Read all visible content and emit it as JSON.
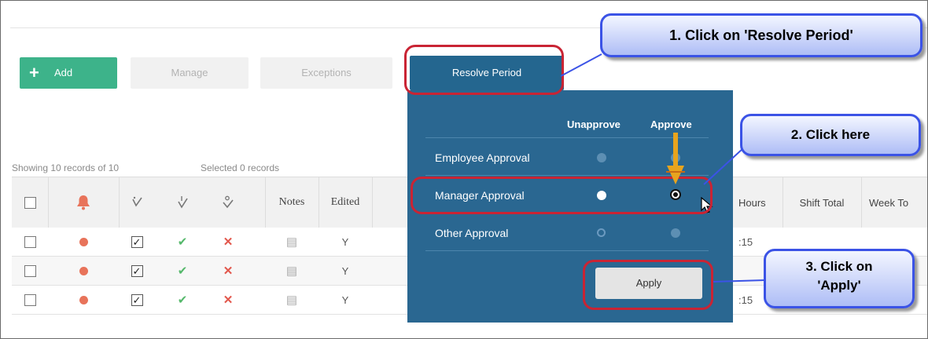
{
  "toolbar": {
    "add_label": "Add",
    "manage_label": "Manage",
    "exceptions_label": "Exceptions",
    "resolve_label": "Resolve Period"
  },
  "records": {
    "showing": "Showing 10 records of 10",
    "selected": "Selected 0 records"
  },
  "table": {
    "headers": {
      "notes": "Notes",
      "edited": "Edited",
      "hours": "Hours",
      "shift_total": "Shift Total",
      "week_total": "Week To"
    },
    "rows": [
      {
        "edited": "Y",
        "hours": ":15"
      },
      {
        "edited": "Y",
        "hours": ""
      },
      {
        "edited": "Y",
        "hours": ":15"
      }
    ]
  },
  "resolve_panel": {
    "col_unapprove": "Unapprove",
    "col_approve": "Approve",
    "rows": [
      {
        "label": "Employee Approval",
        "unapprove": "dim",
        "approve": "dim"
      },
      {
        "label": "Manager Approval",
        "unapprove": "on",
        "approve": "selected"
      },
      {
        "label": "Other Approval",
        "unapprove": "empty",
        "approve": "dim"
      }
    ],
    "apply_label": "Apply"
  },
  "callouts": {
    "step1": "1. Click on 'Resolve Period'",
    "step2": "2. Click here",
    "step3": "3. Click on 'Apply'"
  },
  "colors": {
    "add_green": "#3db38a",
    "panel_blue": "#2a6791",
    "highlight_red": "#c92434",
    "callout_blue": "#3b53e6"
  }
}
